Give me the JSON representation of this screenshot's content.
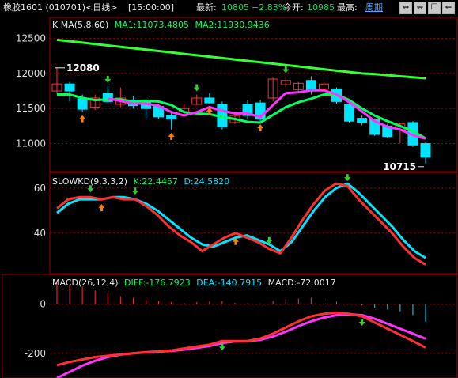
{
  "header": {
    "instrument": "橡胶1601 (010701)<日线>",
    "time": "[15:00:00]",
    "latest_label": "最新:",
    "latest_value": "10805",
    "change_pct": "−2.83%",
    "open_label": "今开:",
    "open_value": "10985",
    "high_label": "最高:",
    "period_link": "周期",
    "buttons": [
      "⇔",
      "⇔",
      "☐",
      "⇐"
    ]
  },
  "colors": {
    "up": "#ff3030",
    "down": "#00e5ff",
    "ma5": "#ff33ff",
    "ma8": "#00ff60",
    "ma60": "#33ff33",
    "grid": "#9b0000",
    "axis_text": "#dcdcdc"
  },
  "chart_data": [
    {
      "type": "candlestick",
      "title": "K  MA(5,8,60)",
      "legend": [
        "MA1:11073.4805",
        "MA2:11930.9436"
      ],
      "ylim": [
        10600,
        12800
      ],
      "yticks": [
        12500,
        12000,
        11500,
        11000
      ],
      "annotations": [
        {
          "label": "12080",
          "index": 0,
          "value": 12080
        },
        {
          "label": "10715",
          "index": 29,
          "value": 10715
        }
      ],
      "candles": [
        {
          "o": 11750,
          "c": 11850,
          "h": 12080,
          "l": 11700
        },
        {
          "o": 11850,
          "c": 11750,
          "h": 11880,
          "l": 11600
        },
        {
          "o": 11640,
          "c": 11490,
          "h": 11700,
          "l": 11450
        },
        {
          "o": 11520,
          "c": 11650,
          "h": 11700,
          "l": 11480
        },
        {
          "o": 11720,
          "c": 11600,
          "h": 11820,
          "l": 11580
        },
        {
          "o": 11560,
          "c": 11650,
          "h": 11800,
          "l": 11520
        },
        {
          "o": 11620,
          "c": 11540,
          "h": 11680,
          "l": 11500
        },
        {
          "o": 11600,
          "c": 11500,
          "h": 11640,
          "l": 11360
        },
        {
          "o": 11530,
          "c": 11380,
          "h": 11560,
          "l": 11350
        },
        {
          "o": 11400,
          "c": 11350,
          "h": 11450,
          "l": 11200
        },
        {
          "o": 11450,
          "c": 11500,
          "h": 11560,
          "l": 11420
        },
        {
          "o": 11560,
          "c": 11650,
          "h": 11700,
          "l": 11550
        },
        {
          "o": 11650,
          "c": 11580,
          "h": 11720,
          "l": 11560
        },
        {
          "o": 11560,
          "c": 11240,
          "h": 11600,
          "l": 11200
        },
        {
          "o": 11300,
          "c": 11400,
          "h": 11450,
          "l": 11280
        },
        {
          "o": 11560,
          "c": 11400,
          "h": 11620,
          "l": 11350
        },
        {
          "o": 11580,
          "c": 11350,
          "h": 11620,
          "l": 11320
        },
        {
          "o": 11650,
          "c": 11920,
          "h": 11940,
          "l": 11600
        },
        {
          "o": 11840,
          "c": 11900,
          "h": 11960,
          "l": 11800
        },
        {
          "o": 11770,
          "c": 11860,
          "h": 11880,
          "l": 11720
        },
        {
          "o": 11900,
          "c": 11750,
          "h": 11960,
          "l": 11700
        },
        {
          "o": 11780,
          "c": 11850,
          "h": 11960,
          "l": 11700
        },
        {
          "o": 11780,
          "c": 11600,
          "h": 11800,
          "l": 11570
        },
        {
          "o": 11560,
          "c": 11320,
          "h": 11600,
          "l": 11300
        },
        {
          "o": 11360,
          "c": 11300,
          "h": 11400,
          "l": 11260
        },
        {
          "o": 11340,
          "c": 11130,
          "h": 11360,
          "l": 11110
        },
        {
          "o": 11250,
          "c": 11100,
          "h": 11280,
          "l": 11080
        },
        {
          "o": 11200,
          "c": 11280,
          "h": 11300,
          "l": 11000
        },
        {
          "o": 11300,
          "c": 10980,
          "h": 11320,
          "l": 10950
        },
        {
          "o": 11000,
          "c": 10805,
          "h": 11020,
          "l": 10715
        }
      ],
      "ma5": [
        null,
        null,
        null,
        null,
        11640,
        11610,
        11570,
        11570,
        11540,
        11450,
        11400,
        11450,
        11520,
        11470,
        11430,
        11430,
        11380,
        11550,
        11720,
        11730,
        11760,
        11760,
        11700,
        11590,
        11460,
        11320,
        11240,
        11200,
        11120,
        11070
      ],
      "ma8": [
        11700,
        11700,
        11650,
        11620,
        11630,
        11630,
        11600,
        11610,
        11600,
        11550,
        11450,
        11430,
        11420,
        11380,
        11350,
        11310,
        11300,
        11410,
        11520,
        11590,
        11640,
        11700,
        11700,
        11620,
        11500,
        11400,
        11320,
        11250,
        11180,
        11073
      ],
      "ma60": [
        12480,
        12460,
        12440,
        12420,
        12400,
        12380,
        12360,
        12340,
        12320,
        12300,
        12280,
        12260,
        12240,
        12220,
        12200,
        12180,
        12160,
        12140,
        12120,
        12100,
        12080,
        12060,
        12040,
        12020,
        12000,
        11990,
        11975,
        11960,
        11945,
        11931
      ],
      "buy_arrows": [
        2,
        9,
        12,
        16
      ],
      "sell_arrows": [
        4,
        11,
        18
      ]
    },
    {
      "type": "line",
      "title": "SLOWKD(9,3,3,2)",
      "legend": [
        "K:22.4457",
        "D:24.5820"
      ],
      "ylim": [
        22,
        67
      ],
      "yticks": [
        60,
        40
      ],
      "series": [
        {
          "name": "K",
          "values": [
            51,
            55,
            56,
            56,
            55,
            56,
            55,
            55,
            52,
            48,
            43,
            39,
            36,
            32,
            35,
            38,
            40,
            38,
            36,
            33,
            31,
            38,
            46,
            53,
            59,
            62,
            61,
            55,
            50,
            45,
            40,
            34,
            29,
            26
          ]
        },
        {
          "name": "D",
          "values": [
            49,
            53,
            55,
            55,
            55,
            56,
            56,
            55,
            53,
            50,
            46,
            42,
            38,
            35,
            34,
            36,
            38,
            39,
            37,
            35,
            32,
            36,
            43,
            50,
            56,
            60,
            62,
            58,
            53,
            48,
            43,
            37,
            32,
            29
          ]
        }
      ],
      "buy_arrows": [
        4,
        16
      ],
      "sell_arrows": [
        3,
        7,
        19,
        26
      ]
    },
    {
      "type": "line",
      "title": "MACD(26,12,4)",
      "legend": [
        "DIFF:-176.7923",
        "DEA:-140.7915",
        "MACD:-72.0017"
      ],
      "ylim": [
        -300,
        120
      ],
      "yticks": [
        0,
        -200
      ],
      "series": [
        {
          "name": "DIFF",
          "values": [
            -248,
            -235,
            -225,
            -215,
            -210,
            -205,
            -200,
            -195,
            -192,
            -188,
            -180,
            -172,
            -165,
            -150,
            -150,
            -150,
            -140,
            -120,
            -95,
            -70,
            -50,
            -40,
            -35,
            -40,
            -50,
            -75,
            -100,
            -125,
            -150,
            -177
          ]
        },
        {
          "name": "DEA",
          "values": [
            -300,
            -275,
            -250,
            -230,
            -215,
            -205,
            -200,
            -196,
            -193,
            -190,
            -185,
            -178,
            -170,
            -158,
            -152,
            -150,
            -145,
            -132,
            -112,
            -90,
            -70,
            -55,
            -45,
            -42,
            -45,
            -60,
            -80,
            -100,
            -120,
            -141
          ]
        },
        {
          "name": "MACD",
          "values": [
            95,
            78,
            70,
            55,
            45,
            32,
            25,
            18,
            12,
            8,
            4,
            8,
            10,
            12,
            5,
            3,
            2,
            12,
            20,
            22,
            25,
            15,
            10,
            2,
            -5,
            -15,
            -22,
            -30,
            -45,
            -72
          ]
        }
      ],
      "sell_arrows": [
        13,
        24
      ]
    }
  ]
}
